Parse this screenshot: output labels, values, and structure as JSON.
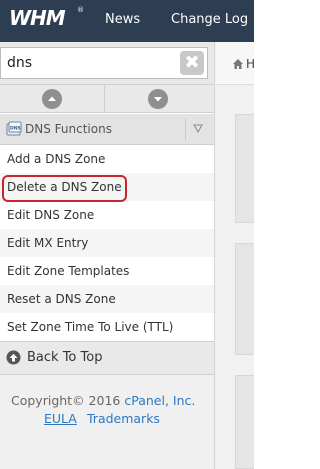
{
  "header": {
    "logo_text": "WHM",
    "trademark": "®",
    "nav": [
      {
        "label": "News"
      },
      {
        "label": "Change Log"
      }
    ]
  },
  "search": {
    "value": "dns",
    "clear_glyph": "✖"
  },
  "breadcrumb": {
    "visible_text": "H"
  },
  "sidebar": {
    "category": {
      "icon_text": "DNS",
      "label": "DNS Functions",
      "chevron": "▽"
    },
    "items": [
      {
        "label": "Add a DNS Zone"
      },
      {
        "label": "Delete a DNS Zone"
      },
      {
        "label": "Edit DNS Zone"
      },
      {
        "label": "Edit MX Entry"
      },
      {
        "label": "Edit Zone Templates"
      },
      {
        "label": "Reset a DNS Zone"
      },
      {
        "label": "Set Zone Time To Live (TTL)"
      }
    ],
    "back_to_top": "Back To Top"
  },
  "footer": {
    "copyright_prefix": "Copyright© 2016 ",
    "copyright_brand": "cPanel, Inc.",
    "links": [
      {
        "label": "EULA"
      },
      {
        "label": "Trademarks"
      }
    ]
  },
  "colors": {
    "header_bg": "#2d3d52",
    "link": "#2b78c2",
    "highlight": "#c8262d"
  }
}
